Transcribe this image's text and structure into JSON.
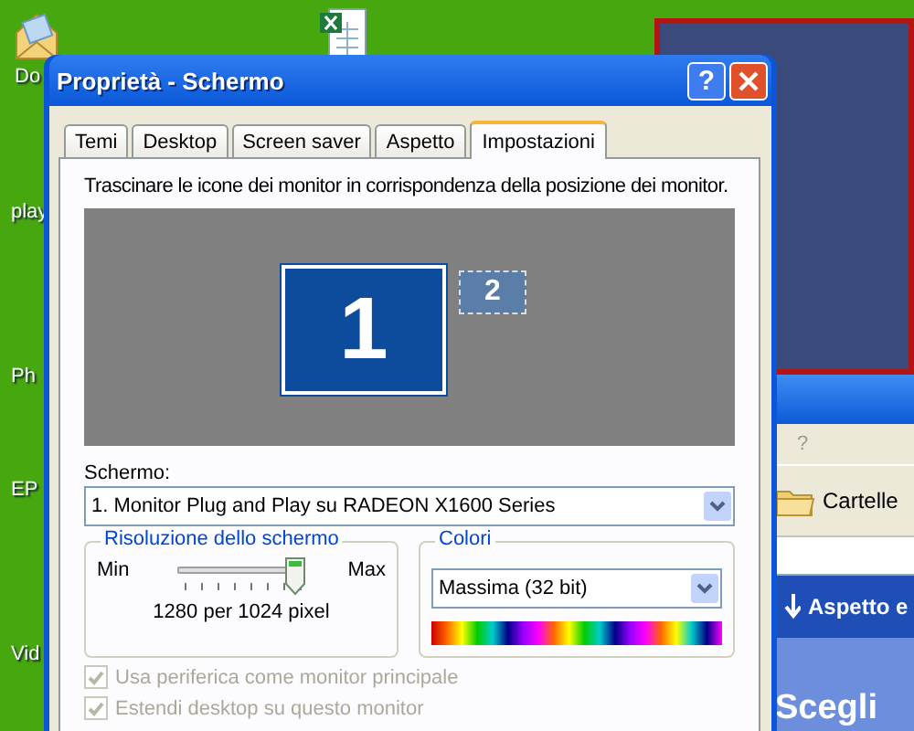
{
  "desktop_icons": [
    {
      "label": "Do",
      "kind": "envelope"
    },
    {
      "label": "play",
      "kind": "blank"
    },
    {
      "label": "Ph",
      "kind": "blank"
    },
    {
      "label": "EP",
      "kind": "blank"
    },
    {
      "label": "Vid",
      "kind": "blank"
    },
    {
      "kind": "sheet"
    }
  ],
  "background_window": {
    "menu": "?",
    "toolbar_button": "Cartelle",
    "panel_heading": "Aspetto e",
    "panel_title": "Scegli"
  },
  "window": {
    "title": "Proprietà - Schermo",
    "buttons": [
      "?"
    ]
  },
  "tabs": [
    {
      "label": "Temi",
      "selected": false
    },
    {
      "label": "Desktop",
      "selected": false
    },
    {
      "label": "Screen saver",
      "selected": false
    },
    {
      "label": "Aspetto",
      "selected": false
    },
    {
      "label": "Impostazioni",
      "selected": true
    }
  ],
  "instruction": "Trascinare le icone dei monitor in corrispondenza della posizione dei monitor.",
  "monitors": [
    {
      "number": "1",
      "selected": true
    },
    {
      "number": "2",
      "selected": false
    }
  ],
  "display": {
    "label": "Schermo:",
    "value": "1. Monitor Plug and Play su RADEON X1600 Series"
  },
  "resolution": {
    "title": "Risoluzione dello schermo",
    "min": "Min",
    "max": "Max",
    "level": 1,
    "reading": "1280 per 1024 pixel"
  },
  "colors": {
    "title": "Colori",
    "value": "Massima (32 bit)"
  },
  "options": [
    {
      "label": "Usa periferica come monitor principale",
      "checked": true,
      "disabled": true
    },
    {
      "label": "Estendi desktop su questo monitor",
      "checked": true,
      "disabled": true
    }
  ]
}
